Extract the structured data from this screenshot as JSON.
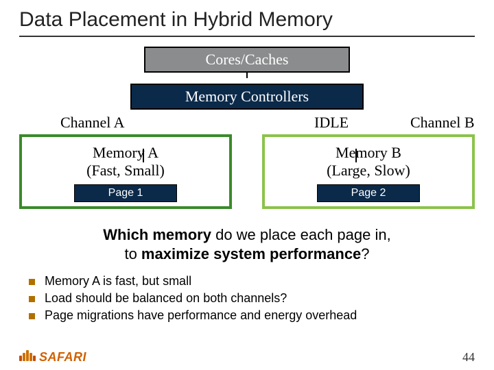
{
  "title": "Data Placement in Hybrid Memory",
  "diagram": {
    "cores": "Cores/Caches",
    "memctrl": "Memory Controllers",
    "channel_a": "Channel A",
    "idle": "IDLE",
    "channel_b": "Channel B",
    "mem_a_line1": "Memory A",
    "mem_a_line2": "(Fast, Small)",
    "mem_b_line1": "Memory B",
    "mem_b_line2": "(Large, Slow)",
    "page1": "Page 1",
    "page2": "Page 2"
  },
  "question": {
    "prefix": "Which memory",
    "mid": " do we place each page in,",
    "line2a": "to ",
    "strong": "maximize system performance",
    "suffix": "?"
  },
  "bullets": [
    "Memory A is fast, but small",
    "Load should be balanced on both channels?",
    "Page migrations have performance and energy overhead"
  ],
  "logo": "SAFARI",
  "page_number": "44"
}
